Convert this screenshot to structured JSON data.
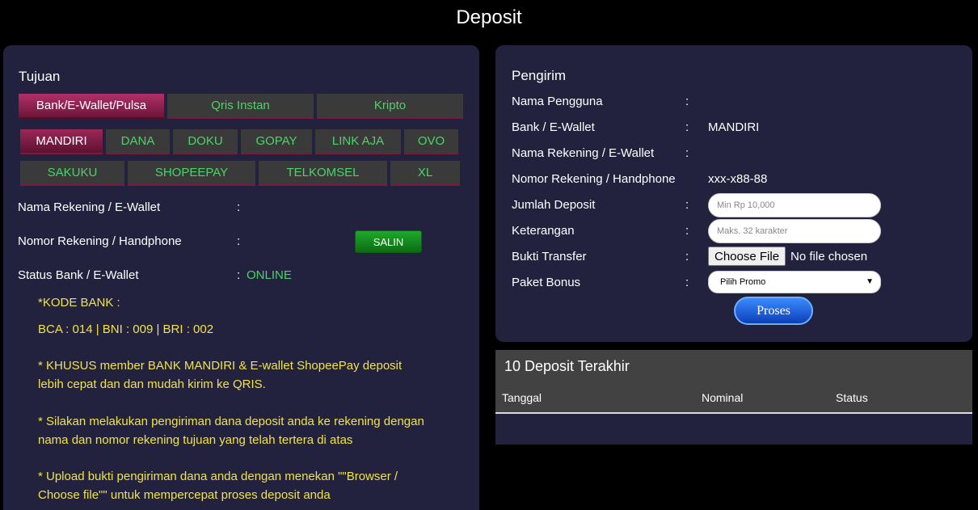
{
  "page_title": "Deposit",
  "left": {
    "heading": "Tujuan",
    "tabs": [
      {
        "label": "Bank/E-Wallet/Pulsa",
        "active": true
      },
      {
        "label": "Qris Instan",
        "active": false
      },
      {
        "label": "Kripto",
        "active": false
      }
    ],
    "banks_row1": [
      "MANDIRI",
      "DANA",
      "DOKU",
      "GOPAY",
      "LINK AJA",
      "OVO"
    ],
    "banks_row2": [
      "SAKUKU",
      "SHOPEEPAY",
      "TELKOMSEL",
      "XL"
    ],
    "active_bank": "MANDIRI",
    "fields": {
      "nama_label": "Nama Rekening / E-Wallet",
      "nomor_label": "Nomor Rekening / Handphone",
      "status_label": "Status Bank / E-Wallet",
      "colon": ":",
      "status_value": "ONLINE"
    },
    "salin_label": "SALIN",
    "notes": {
      "kode_title": "*KODE BANK :",
      "kode_values": "BCA : 014 | BNI : 009 | BRI : 002",
      "note1": "* KHUSUS member BANK MANDIRI & E-wallet ShopeePay deposit lebih cepat dan dan mudah kirim ke QRIS.",
      "note2": "* Silakan melakukan pengiriman dana deposit anda ke rekening dengan nama dan nomor rekening tujuan yang telah tertera di atas",
      "note3": "* Upload bukti pengiriman dana anda dengan menekan \"\"Browser / Choose file\"\" untuk mempercepat proses deposit anda"
    }
  },
  "right": {
    "heading": "Pengirim",
    "colon": ":",
    "nama_pengguna_label": "Nama Pengguna",
    "bank_label": "Bank / E-Wallet",
    "bank_value": "MANDIRI",
    "nama_rekening_label": "Nama Rekening / E-Wallet",
    "nomor_label": "Nomor Rekening / Handphone",
    "nomor_value": "xxx-x88-88",
    "jumlah_label": "Jumlah Deposit",
    "jumlah_placeholder": "Min Rp 10,000",
    "keterangan_label": "Keterangan",
    "keterangan_placeholder": "Maks. 32 karakter",
    "bukti_label": "Bukti Transfer",
    "file_button": "Choose File",
    "file_status": "No file chosen",
    "paket_label": "Paket Bonus",
    "paket_selected": "Pilih Promo",
    "proses_label": "Proses"
  },
  "history": {
    "title": "10 Deposit Terakhir",
    "columns": [
      "Tanggal",
      "Nominal",
      "Status"
    ]
  }
}
